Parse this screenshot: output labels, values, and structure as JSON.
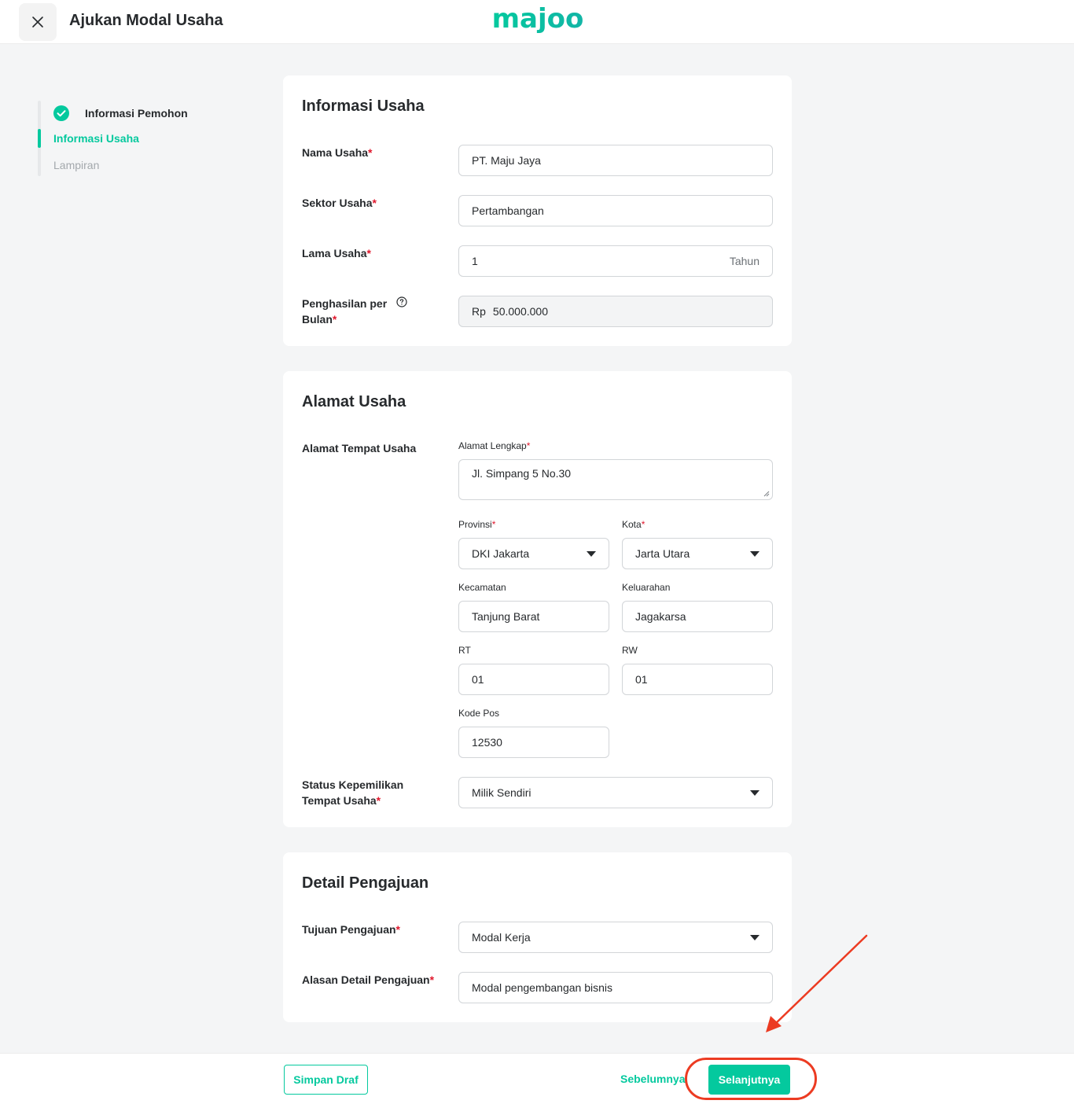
{
  "header": {
    "title": "Ajukan Modal Usaha",
    "logo_text": "majoo"
  },
  "stepper": {
    "steps": [
      {
        "label": "Informasi Pemohon",
        "state": "done"
      },
      {
        "label": "Informasi Usaha",
        "state": "active"
      },
      {
        "label": "Lampiran",
        "state": "pending"
      }
    ]
  },
  "informasi_usaha": {
    "title": "Informasi Usaha",
    "nama_usaha": {
      "label": "Nama Usaha",
      "value": "PT. Maju Jaya"
    },
    "sektor_usaha": {
      "label": "Sektor Usaha",
      "value": "Pertambangan"
    },
    "lama_usaha": {
      "label": "Lama Usaha",
      "value": "1",
      "suffix": "Tahun"
    },
    "penghasilan": {
      "label_line1": "Penghasilan per",
      "label_line2": "Bulan",
      "prefix": "Rp",
      "value": "50.000.000"
    }
  },
  "alamat_usaha": {
    "title": "Alamat Usaha",
    "section_label": "Alamat Tempat Usaha",
    "alamat_lengkap": {
      "label": "Alamat Lengkap",
      "value": "Jl. Simpang 5 No.30"
    },
    "provinsi": {
      "label": "Provinsi",
      "value": "DKI Jakarta"
    },
    "kota": {
      "label": "Kota",
      "value": "Jarta Utara"
    },
    "kecamatan": {
      "label": "Kecamatan",
      "value": "Tanjung Barat"
    },
    "keluarahan": {
      "label": "Keluarahan",
      "value": "Jagakarsa"
    },
    "rt": {
      "label": "RT",
      "value": "01"
    },
    "rw": {
      "label": "RW",
      "value": "01"
    },
    "kode_pos": {
      "label": "Kode Pos",
      "value": "12530"
    },
    "status_kepemilikan": {
      "label_line1": "Status Kepemilikan",
      "label_line2": "Tempat Usaha",
      "value": "Milik Sendiri"
    }
  },
  "detail_pengajuan": {
    "title": "Detail Pengajuan",
    "tujuan": {
      "label": "Tujuan Pengajuan",
      "value": "Modal Kerja"
    },
    "alasan": {
      "label": "Alasan Detail Pengajuan",
      "value": "Modal pengembangan bisnis"
    }
  },
  "footer": {
    "draft_label": "Simpan Draf",
    "prev_label": "Sebelumnya",
    "next_label": "Selanjutnya"
  },
  "required_mark": "*",
  "colors": {
    "accent": "#04c99e",
    "required": "#e0182d",
    "annotation": "#ec3b22"
  }
}
